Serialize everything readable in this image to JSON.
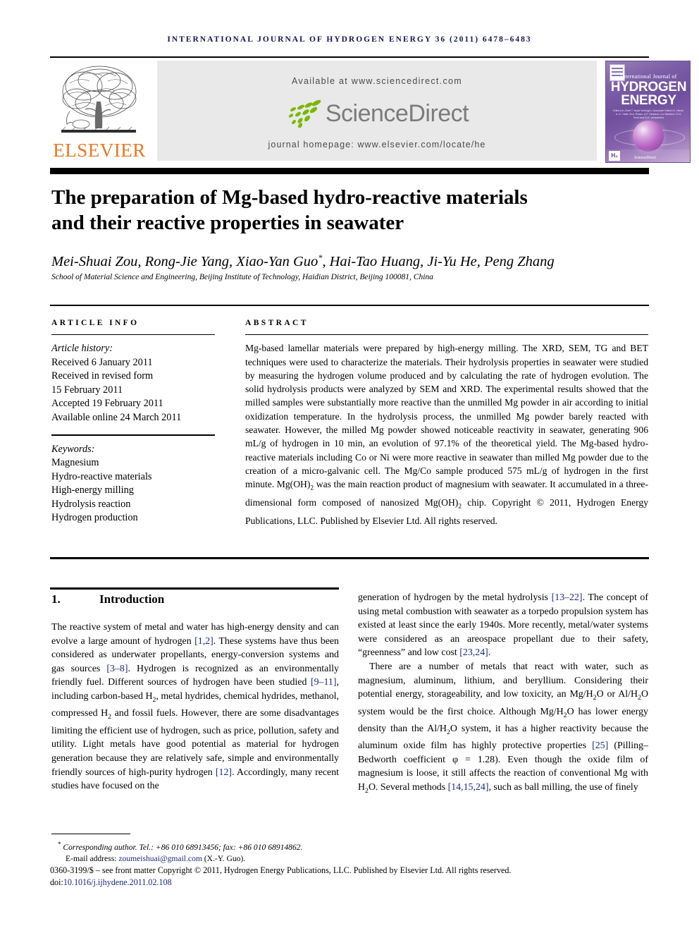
{
  "journal_header": {
    "running_head": "INTERNATIONAL JOURNAL OF HYDROGEN ENERGY 36 (2011) 6478–6483",
    "publisher_logo_text": "ELSEVIER",
    "available_at": "Available at www.sciencedirect.com",
    "sciencedirect_wordmark": "ScienceDirect",
    "journal_homepage": "journal homepage: www.elsevier.com/locate/he",
    "cover": {
      "line1": "International Journal of",
      "line2": "HYDROGEN",
      "line3": "ENERGY",
      "editors": "Editors-in-Chief  T. Nejat Veziroglu / Associate Editors  D. Hissel, A.-G. Olabi, M.A. Rosen, A.P. Simpson, Lin Stanford / G.G. Scott and D.M. Venkatesha",
      "badge": "H₂",
      "sciencedirect": "ScienceDirect"
    }
  },
  "article": {
    "title_line1": "The preparation of Mg-based hydro-reactive materials",
    "title_line2": "and their reactive properties in seawater",
    "authors": "Mei-Shuai Zou, Rong-Jie Yang, Xiao-Yan Guo",
    "authors_tail": ", Hai-Tao Huang, Ji-Yu He, Peng Zhang",
    "corresponding_marker": "*",
    "affiliation": "School of Material Science and Engineering, Beijing Institute of Technology, Haidian District, Beijing 100081, China"
  },
  "article_info": {
    "heading": "ARTICLE INFO",
    "history_label": "Article history:",
    "history": [
      "Received 6 January 2011",
      "Received in revised form",
      "15 February 2011",
      "Accepted 19 February 2011",
      "Available online 24 March 2011"
    ],
    "keywords_label": "Keywords:",
    "keywords": [
      "Magnesium",
      "Hydro-reactive materials",
      "High-energy milling",
      "Hydrolysis reaction",
      "Hydrogen production"
    ]
  },
  "abstract": {
    "heading": "ABSTRACT",
    "part1": "Mg-based lamellar materials were prepared by high-energy milling. The XRD, SEM, TG and BET techniques were used to characterize the materials. Their hydrolysis properties in seawater were studied by measuring the hydrogen volume produced and by calculating the rate of hydrogen evolution. The solid hydrolysis products were analyzed by SEM and XRD. The experimental results showed that the milled samples were substantially more reactive than the unmilled Mg powder in air according to initial oxidization temperature. In the hydrolysis process, the unmilled Mg powder barely reacted with seawater. However, the milled Mg powder showed noticeable reactivity in seawater, generating 906 mL/g of hydrogen in 10 min, an evolution of 97.1% of the theoretical yield. The Mg-based hydro-reactive materials including Co or Ni were more reactive in seawater than milled Mg powder due to the creation of a micro-galvanic cell. The Mg/Co sample produced 575 mL/g of hydrogen in the first minute. Mg(OH)",
    "sub1": "2",
    "part2": " was the main reaction product of magnesium with seawater. It accumulated in a three-dimensional form composed of nanosized Mg(OH)",
    "sub2": "2",
    "part3": " chip. Copyright © 2011, Hydrogen Energy Publications, LLC. Published by Elsevier Ltd. All rights reserved."
  },
  "introduction": {
    "number": "1.",
    "heading": "Introduction",
    "left_p1_a": "The reactive system of metal and water has high-energy density and can evolve a large amount of hydrogen ",
    "ref_1_2": "[1,2]",
    "left_p1_b": ". These systems have thus been considered as underwater propellants, energy-conversion systems and gas sources ",
    "ref_3_8": "[3–8]",
    "left_p1_c": ". Hydrogen is recognized as an environmentally friendly fuel. Different sources of hydrogen have been studied ",
    "ref_9_11": "[9–11]",
    "left_p1_d": ", including carbon-based H",
    "sub_h2_a": "2",
    "left_p1_e": ", metal hydrides, chemical hydrides, methanol, compressed H",
    "sub_h2_b": "2",
    "left_p1_f": " and fossil fuels. However, there are some disadvantages limiting the efficient use of hydrogen, such as price, pollution, safety and utility. Light metals have good potential as material for hydrogen generation because they are relatively safe, simple and environmentally friendly sources of high-purity hydrogen ",
    "ref_12": "[12]",
    "left_p1_g": ". Accordingly, many recent studies have focused on the ",
    "right_p1_a": "generation of hydrogen by the metal hydrolysis ",
    "ref_13_22": "[13–22]",
    "right_p1_b": ". The concept of using metal combustion with seawater as a torpedo propulsion system has existed at least since the early 1940s. More recently, metal/water systems were considered as an areospace propellant due to their safety, “greenness” and low cost ",
    "ref_23_24": "[23,24]",
    "right_p1_c": ".",
    "right_p2_a": "There are a number of metals that react with water, such as magnesium, aluminum, lithium, and beryllium. Considering their potential energy, storageability, and low toxicity, an Mg/H",
    "sub_a": "2",
    "right_p2_b": "O or Al/H",
    "sub_b": "2",
    "right_p2_c": "O system would be the first choice. Although Mg/H",
    "sub_c": "2",
    "right_p2_d": "O has lower energy density than the Al/H",
    "sub_d": "2",
    "right_p2_e": "O system, it has a higher reactivity because the aluminum oxide film has highly protective properties ",
    "ref_25": "[25]",
    "right_p2_f": " (Pilling–Bedworth coefficient φ = 1.28). Even though the oxide film of magnesium is loose, it still affects the reaction of conventional Mg with H",
    "sub_e": "2",
    "right_p2_g": "O. Several methods ",
    "ref_14_15_24": "[14,15,24]",
    "right_p2_h": ", such as ball milling, the use of finely"
  },
  "footer": {
    "corresponding_marker": "*",
    "corresponding": "Corresponding author. Tel.: +86 010 68913456; fax: +86 010 68914862.",
    "email_label": "E-mail address: ",
    "email": "zoumeishuai@gmail.com",
    "email_suffix": " (X.-Y. Guo).",
    "issn_line": "0360-3199/$ – see front matter Copyright © 2011, Hydrogen Energy Publications, LLC. Published by Elsevier Ltd. All rights reserved.",
    "doi_label": "doi:",
    "doi": "10.1016/j.ijhydene.2011.02.108"
  },
  "colors": {
    "running_head": "#141452",
    "elsevier_orange": "#E87722",
    "banner_bg": "#E9E9E9",
    "sciencedirect_green": "#7AB800",
    "sciencedirect_gray": "#7B7B7B",
    "reference_blue": "#1b2a7a"
  }
}
